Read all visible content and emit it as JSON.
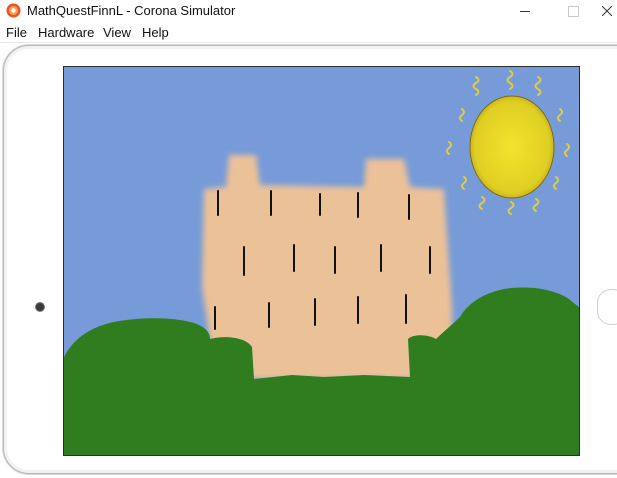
{
  "window": {
    "title": "MathQuestFinnL - Corona Simulator",
    "app_icon": "corona-simulator-icon",
    "controls": {
      "minimize_icon": "minimize-icon",
      "maximize_icon": "maximize-icon",
      "close_icon": "close-icon"
    }
  },
  "menu": {
    "items": [
      {
        "label": "File"
      },
      {
        "label": "Hardware"
      },
      {
        "label": "View"
      },
      {
        "label": "Help"
      }
    ]
  },
  "scene": {
    "sky_color": "#769bd8",
    "castle_color": "#ebc198",
    "grass_color": "#2f7d1f",
    "sun_color": "#e8dc28",
    "window_mark_color": "#111111"
  }
}
